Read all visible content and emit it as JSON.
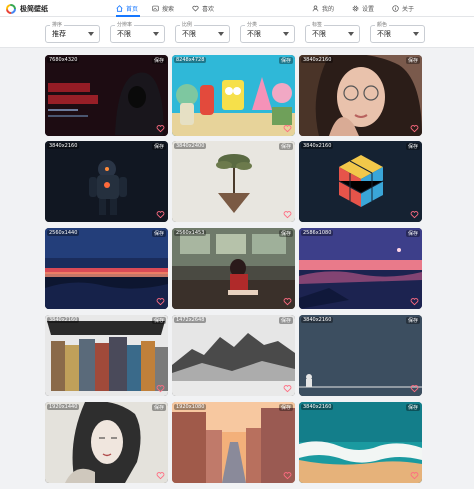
{
  "app": {
    "title": "极简壁纸",
    "brand_colors": [
      "#e94235",
      "#fbbc04",
      "#34a853",
      "#4285f4"
    ]
  },
  "nav": {
    "home": "首页",
    "search": "搜索",
    "favorites": "喜欢",
    "mine": "我的",
    "settings": "设置",
    "about": "关于",
    "active": "home",
    "accent": "#1677ff"
  },
  "filters": [
    {
      "label": "排序",
      "value": "推荐"
    },
    {
      "label": "分辨率",
      "value": "不限"
    },
    {
      "label": "比例",
      "value": "不限"
    },
    {
      "label": "分类",
      "value": "不限"
    },
    {
      "label": "标签",
      "value": "不限"
    },
    {
      "label": "颜色",
      "value": "不限"
    }
  ],
  "wallpapers": [
    {
      "resolution": "7680x4320",
      "save": "保存",
      "scene": "hacker-hood"
    },
    {
      "resolution": "8248x4728",
      "save": "保存",
      "scene": "spongebob-cartoon"
    },
    {
      "resolution": "3840x2160",
      "save": "保存",
      "scene": "girl-glasses"
    },
    {
      "resolution": "3840x2160",
      "save": "保存",
      "scene": "space-robot"
    },
    {
      "resolution": "3840x2400",
      "save": "保存",
      "scene": "floating-tree-rock"
    },
    {
      "resolution": "3840x2160",
      "save": "保存",
      "scene": "colorful-cube"
    },
    {
      "resolution": "2560x1440",
      "save": "保存",
      "scene": "red-horizon-sky"
    },
    {
      "resolution": "2560x1453",
      "save": "保存",
      "scene": "anime-girl-train"
    },
    {
      "resolution": "2586x1080",
      "save": "保存",
      "scene": "purple-lake-sunset"
    },
    {
      "resolution": "3840x2160",
      "save": "保存",
      "scene": "overwatch-heroes"
    },
    {
      "resolution": "1472x2648",
      "save": "保存",
      "scene": "misty-mountains"
    },
    {
      "resolution": "3840x2160",
      "save": "保存",
      "scene": "minimal-cat-line"
    },
    {
      "resolution": "1920x1440",
      "save": "保存",
      "scene": "ink-portrait"
    },
    {
      "resolution": "1920x1080",
      "save": "保存",
      "scene": "city-street-sunset"
    },
    {
      "resolution": "3840x2160",
      "save": "保存",
      "scene": "ocean-beach-aerial"
    }
  ]
}
